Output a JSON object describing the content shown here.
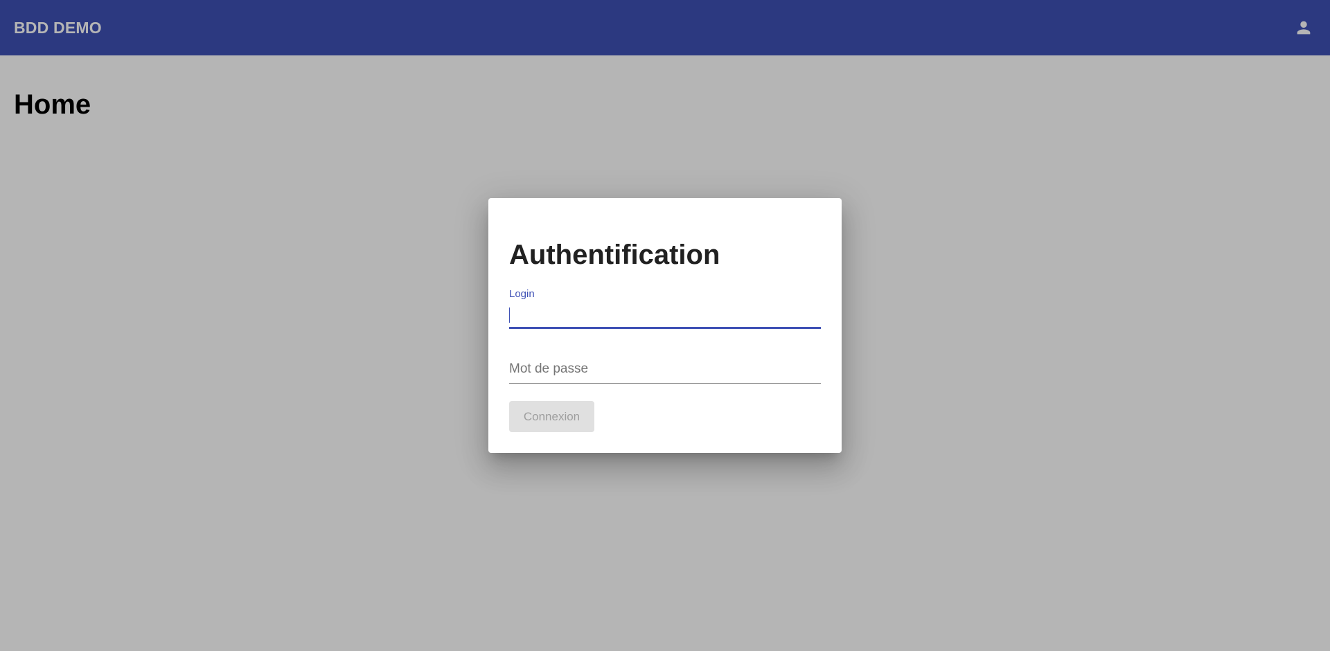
{
  "toolbar": {
    "app_title": "BDD DEMO",
    "account_icon": "account-circle-icon",
    "background_color": "#3f51b5"
  },
  "page": {
    "title": "Home"
  },
  "dialog": {
    "title": "Authentification",
    "login": {
      "label": "Login",
      "value": ""
    },
    "password": {
      "label": "Mot de passe",
      "value": ""
    },
    "submit_label": "Connexion",
    "submit_disabled": true
  },
  "colors": {
    "accent": "#3f51b5",
    "disabled_button_bg": "#e0e0e0",
    "disabled_button_text": "#9e9e9e"
  }
}
